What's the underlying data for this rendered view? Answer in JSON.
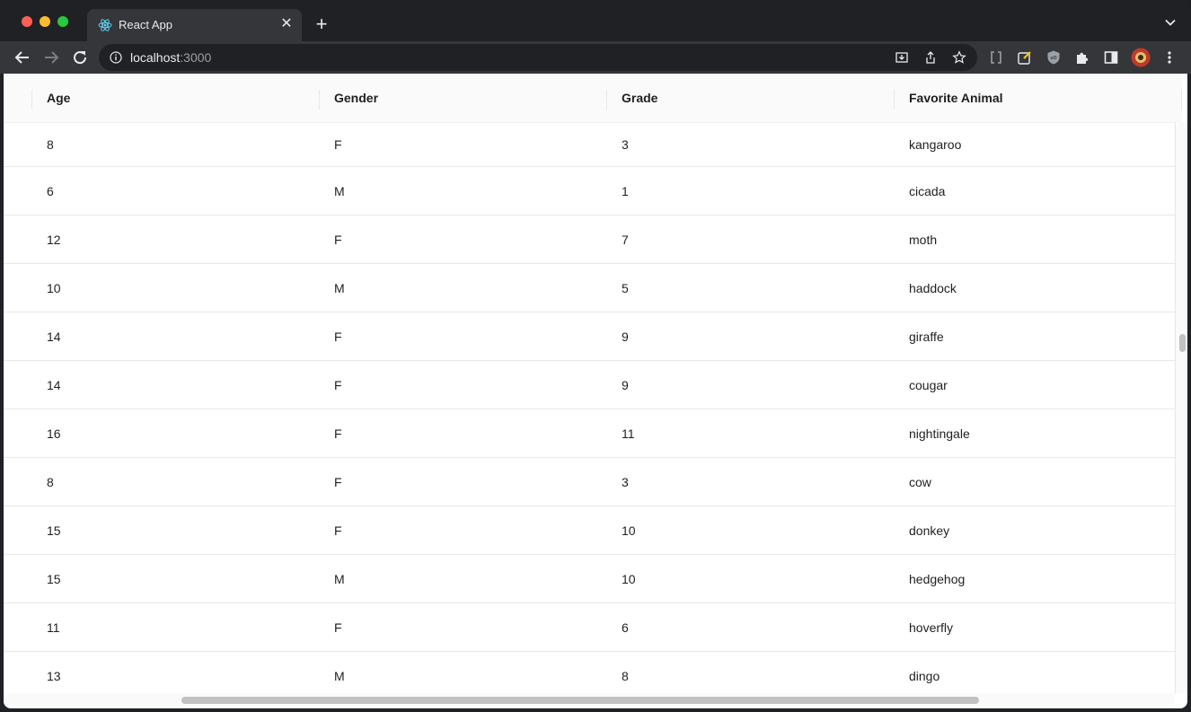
{
  "browser": {
    "tab_title": "React App",
    "url_host": "localhost",
    "url_port": ":3000",
    "accent": "#61dafb"
  },
  "table": {
    "columns": [
      "Age",
      "Gender",
      "Grade",
      "Favorite Animal"
    ],
    "rows": [
      [
        "8",
        "F",
        "3",
        "kangaroo"
      ],
      [
        "6",
        "M",
        "1",
        "cicada"
      ],
      [
        "12",
        "F",
        "7",
        "moth"
      ],
      [
        "10",
        "M",
        "5",
        "haddock"
      ],
      [
        "14",
        "F",
        "9",
        "giraffe"
      ],
      [
        "14",
        "F",
        "9",
        "cougar"
      ],
      [
        "16",
        "F",
        "11",
        "nightingale"
      ],
      [
        "8",
        "F",
        "3",
        "cow"
      ],
      [
        "15",
        "F",
        "10",
        "donkey"
      ],
      [
        "15",
        "M",
        "10",
        "hedgehog"
      ],
      [
        "11",
        "F",
        "6",
        "hoverfly"
      ],
      [
        "13",
        "M",
        "8",
        "dingo"
      ]
    ]
  },
  "icons": {
    "tab_favicon": "react-icon",
    "tab_close": "close-icon",
    "new_tab": "plus-icon",
    "tab_search": "chevron-down-icon",
    "back": "back-arrow-icon",
    "forward": "forward-arrow-icon",
    "reload": "reload-icon",
    "site_info": "info-icon",
    "install": "install-icon",
    "share": "share-icon",
    "bookmark": "star-icon",
    "extensions": [
      "cookie-extension-icon",
      "notes-extension-icon",
      "ublock-extension-icon",
      "puzzle-icon",
      "sidebar-icon",
      "profile-avatar-icon",
      "kebab-menu-icon"
    ]
  }
}
